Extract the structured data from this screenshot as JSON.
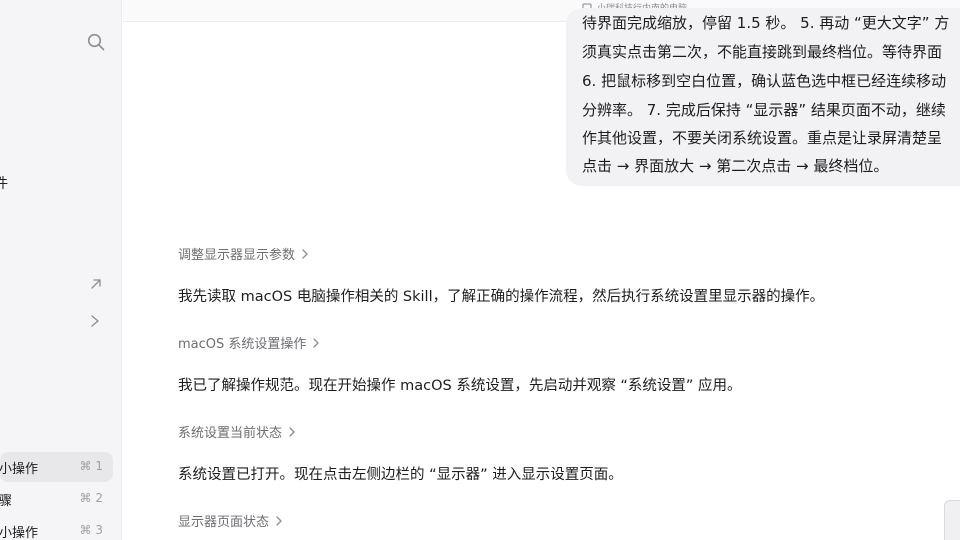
{
  "sidebar": {
    "top_glyph_left": "",
    "top_glyph_right": "",
    "cut_label": "件",
    "items": [
      {
        "label": "小操作",
        "shortcut": "⌘ 1"
      },
      {
        "label": "骤",
        "shortcut": "⌘ 2"
      },
      {
        "label": "小操作",
        "shortcut": "⌘ 3"
      }
    ]
  },
  "topbar": {
    "device_label": "小瑞科技行内南的电脑"
  },
  "user_message": {
    "lines": [
      "待界面完成缩放，停留 1.5 秒。 5. 再动 “更大文字” 方",
      "须真实点击第二次，不能直接跳到最终档位。等待界面",
      "6. 把鼠标移到空白位置，确认蓝色选中框已经连续移动",
      "分辨率。 7. 完成后保持 “显示器” 结果页面不动，继续",
      "作其他设置，不要关闭系统设置。重点是让录屏清楚呈",
      "点击 → 界面放大 → 第二次点击 → 最终档位。"
    ]
  },
  "steps": [
    {
      "title": "调整显示器显示参数",
      "body": "我先读取 macOS 电脑操作相关的 Skill，了解正确的操作流程，然后执行系统设置里显示器的操作。"
    },
    {
      "title": "macOS 系统设置操作",
      "body": "我已了解操作规范。现在开始操作 macOS 系统设置，先启动并观察 “系统设置” 应用。"
    },
    {
      "title": "系统设置当前状态",
      "body": "系统设置已打开。现在点击左侧边栏的 “显示器” 进入显示设置页面。"
    },
    {
      "title": "显示器页面状态",
      "body": ""
    }
  ],
  "colors": {
    "sidebar_bg": "#f5f5f7",
    "bubble_bg": "#f2f2f4",
    "muted_text": "#6e6e73"
  }
}
